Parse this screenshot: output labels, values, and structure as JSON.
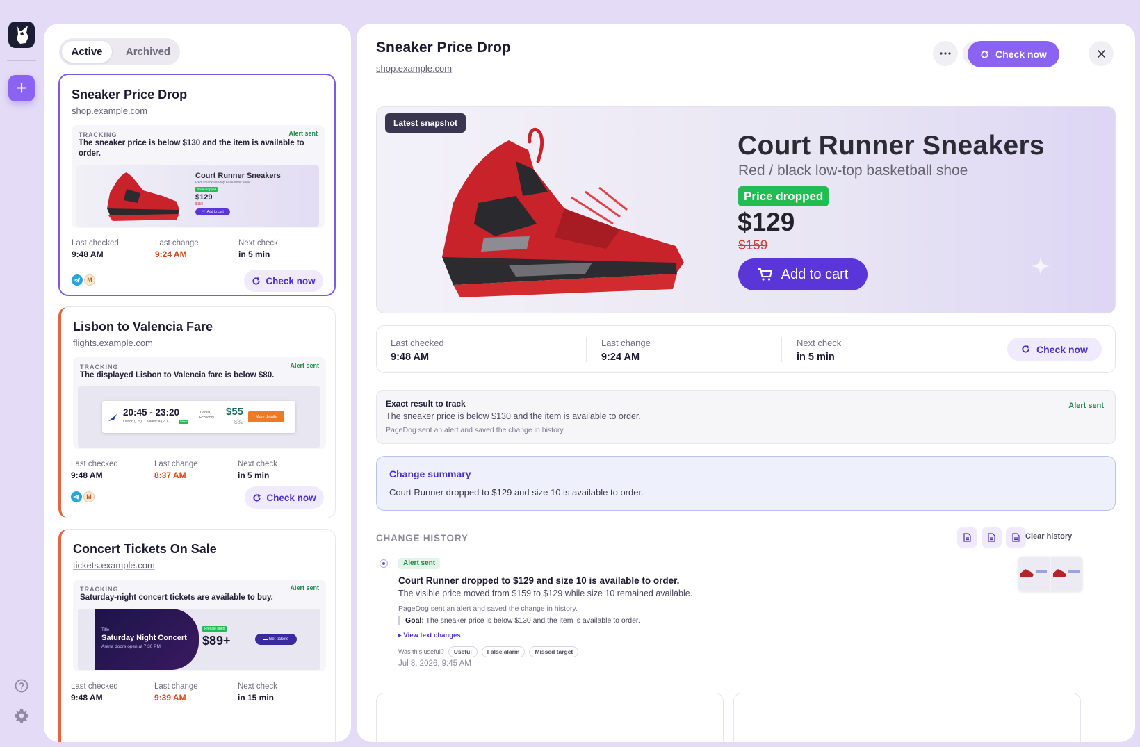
{
  "sidebar": {
    "logo_icon": "dog-head-icon",
    "add_icon": "plus-icon",
    "help_icon": "help-circle-icon",
    "settings_icon": "gear-icon"
  },
  "list": {
    "tabs": [
      {
        "label": "Active"
      },
      {
        "label": "Archived"
      }
    ],
    "meta_labels": {
      "last_checked": "Last checked",
      "last_change": "Last change",
      "next_check": "Next check"
    },
    "tracking_label": "TRACKING",
    "check_now": "Check now",
    "cards": [
      {
        "title": "Sneaker Price Drop",
        "domain": "shop.example.com",
        "alert": "Alert sent",
        "tracking": "The sneaker price is below $130 and the item is available to order.",
        "last_checked": "9:48 AM",
        "last_change": "9:24 AM",
        "next_check": "in 5 min",
        "thumb": {
          "title": "Court Runner Sneakers",
          "sub": "Red / black low-top basketball shoe",
          "badge": "Price dropped",
          "price": "$129",
          "old": "$159",
          "button": "Add to cart"
        }
      },
      {
        "title": "Lisbon to Valencia Fare",
        "domain": "flights.example.com",
        "alert": "Alert sent",
        "tracking": "The displayed Lisbon to Valencia fare is below $80.",
        "last_checked": "9:48 AM",
        "last_change": "8:37 AM",
        "next_check": "in 5 min",
        "thumb": {
          "time": "20:45 - 23:20",
          "route": "Lisbon (LIS) → Valencia (VLC)",
          "tag": "Direct",
          "pax": "1 adult,",
          "cabin": "Economy",
          "price": "$55",
          "old": "$82",
          "button": "More details"
        }
      },
      {
        "title": "Concert Tickets On Sale",
        "domain": "tickets.example.com",
        "alert": "Alert sent",
        "tracking": "Saturday-night concert tickets are available to buy.",
        "last_checked": "9:48 AM",
        "last_change": "9:39 AM",
        "next_check": "in 15 min",
        "thumb": {
          "label": "Title",
          "title": "Saturday Night Concert",
          "sub": "Arena doors open at 7:30 PM",
          "badge": "Presale open",
          "price": "$89+",
          "button": "Get tickets"
        }
      }
    ]
  },
  "detail": {
    "title": "Sneaker Price Drop",
    "domain": "shop.example.com",
    "check_now": "Check now",
    "snapshot": {
      "badge": "Latest snapshot",
      "product": "Court Runner Sneakers",
      "subtitle": "Red / black low-top basketball shoe",
      "price_badge": "Price dropped",
      "price": "$129",
      "old_price": "$159",
      "cart": "Add to cart"
    },
    "stats": {
      "last_checked_label": "Last checked",
      "last_checked": "9:48 AM",
      "last_change_label": "Last change",
      "last_change": "9:24 AM",
      "next_check_label": "Next check",
      "next_check": "in 5 min",
      "check_now": "Check now"
    },
    "exact": {
      "title": "Exact result to track",
      "alert": "Alert sent",
      "text": "The sneaker price is below $130 and the item is available to order.",
      "note": "PageDog sent an alert and saved the change in history."
    },
    "summary": {
      "title": "Change summary",
      "text": "Court Runner dropped to $129 and size 10 is available to order."
    },
    "history": {
      "heading": "CHANGE HISTORY",
      "clear": "Clear history",
      "entry": {
        "badge": "Alert sent",
        "title": "Court Runner dropped to $129 and size 10 is available to order.",
        "desc": "The visible price moved from $159 to $129 while size 10 remained available.",
        "note": "PageDog sent an alert and saved the change in history.",
        "goal_label": "Goal:",
        "goal": "The sneaker price is below $130 and the item is available to order.",
        "view": "▸ View text changes",
        "useful_q": "Was this useful?",
        "feedback": [
          "Useful",
          "False alarm",
          "Missed target"
        ],
        "date": "Jul 8, 2026, 9:45 AM"
      }
    }
  },
  "colors": {
    "accent": "#8a63f2",
    "accent_dark": "#4a2fc7",
    "alert_green": "#1f8a4c",
    "change_orange": "#d8441c",
    "card_orange": "#e8643a"
  }
}
